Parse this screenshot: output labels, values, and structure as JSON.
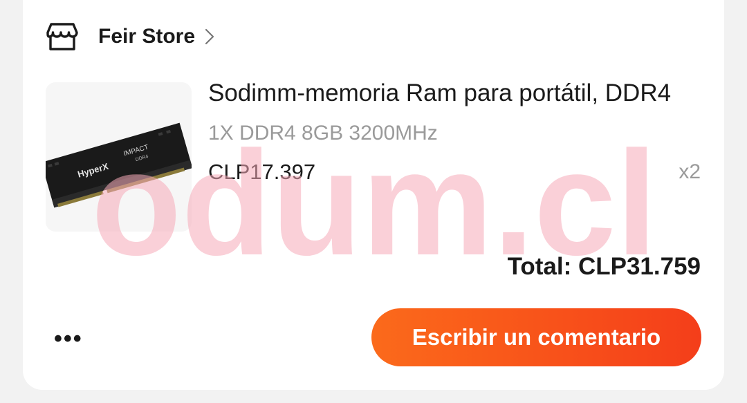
{
  "store": {
    "name": "Feir Store",
    "icon": "store-icon"
  },
  "product": {
    "title": "Sodimm-memoria Ram para portátil, DDR4",
    "variant": "1X DDR4 8GB 3200MHz",
    "price": "CLP17.397",
    "quantity": "x2",
    "image_label_brand": "HyperX",
    "image_label_series": "IMPACT",
    "image_label_type": "DDR4"
  },
  "order": {
    "total": "Total: CLP31.759"
  },
  "actions": {
    "more_label": "•••",
    "comment_label": "Escribir un comentario"
  },
  "watermark": {
    "text": "odum.cl",
    "color": "#f5a9b8"
  },
  "colors": {
    "accent": "#f8521a",
    "text_primary": "#1a1a1a",
    "text_secondary": "#9a9a9a",
    "background": "#f2f2f2"
  }
}
